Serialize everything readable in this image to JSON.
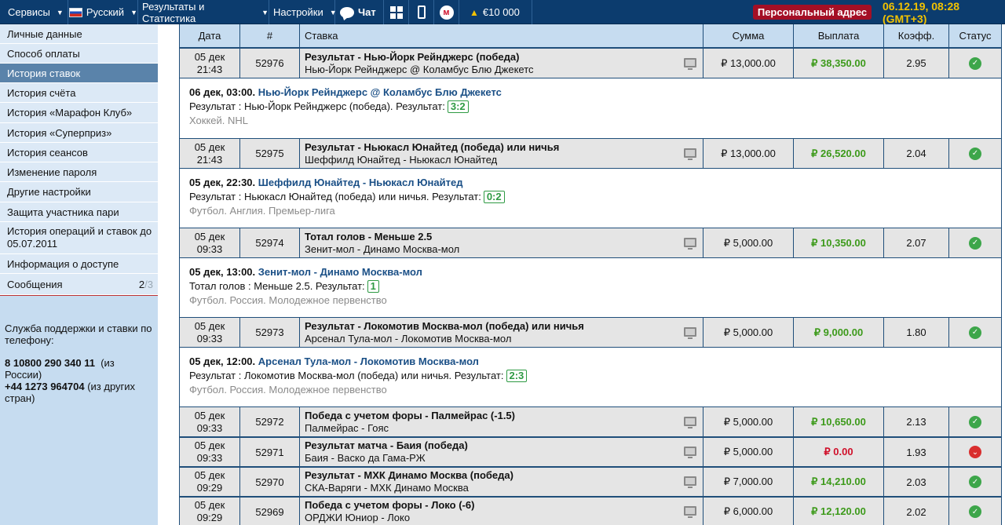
{
  "topbar": {
    "services": "Сервисы",
    "language": "Русский",
    "results": "Результаты и Статистика",
    "settings": "Настройки",
    "chat": "Чат",
    "bonus": "€10 000",
    "personal_address": "Персональный адрес",
    "clock": "06.12.19, 08:28 (GMT+3)"
  },
  "sidebar": {
    "items": [
      {
        "label": "Личные данные"
      },
      {
        "label": "Способ оплаты"
      },
      {
        "label": "История ставок",
        "active": true
      },
      {
        "label": "История счёта"
      },
      {
        "label": "История «Марафон Клуб»"
      },
      {
        "label": "История «Суперприз»"
      },
      {
        "label": "История сеансов"
      },
      {
        "label": "Изменение пароля"
      },
      {
        "label": "Другие настройки"
      },
      {
        "label": "Защита участника пари"
      },
      {
        "label": "История операций и ставок до 05.07.2011"
      },
      {
        "label": "Информация о доступе"
      },
      {
        "label": "Сообщения",
        "count": "2",
        "count_dim": "/3"
      }
    ],
    "support_title": "Служба поддержки и ставки по телефону:",
    "phone_ru": "8 10800 290 340 11",
    "phone_ru_note": "(из России)",
    "phone_intl": "+44 1273 964704",
    "phone_intl_note": "(из других стран)"
  },
  "table": {
    "headers": {
      "date": "Дата",
      "num": "#",
      "stake": "Ставка",
      "sum": "Сумма",
      "pay": "Выплата",
      "coef": "Коэфф.",
      "status": "Статус"
    },
    "rows": [
      {
        "date": "05 дек",
        "time": "21:43",
        "num": "52976",
        "title": "Результат - Нью-Йорк Рейнджерс (победа)",
        "match": "Нью-Йорк Рейнджерс @ Коламбус Блю Джекетс",
        "sum": "₽ 13,000.00",
        "pay": "₽ 38,350.00",
        "coef": "2.95",
        "status": "win",
        "detail": {
          "when": "06 дек, 03:00.",
          "event": "Нью-Йорк Рейнджерс @ Коламбус Блю Джекетс",
          "result_line": "Результат : Нью-Йорк Рейнджерс (победа). Результат:",
          "score": "3:2",
          "league": "Хоккей. NHL"
        }
      },
      {
        "date": "05 дек",
        "time": "21:43",
        "num": "52975",
        "title": "Результат - Ньюкасл Юнайтед (победа) или ничья",
        "match": "Шеффилд Юнайтед - Ньюкасл Юнайтед",
        "sum": "₽ 13,000.00",
        "pay": "₽ 26,520.00",
        "coef": "2.04",
        "status": "win",
        "detail": {
          "when": "05 дек, 22:30.",
          "event": "Шеффилд Юнайтед - Ньюкасл Юнайтед",
          "result_line": "Результат : Ньюкасл Юнайтед (победа) или ничья. Результат:",
          "score": "0:2",
          "league": "Футбол. Англия. Премьер-лига"
        }
      },
      {
        "date": "05 дек",
        "time": "09:33",
        "num": "52974",
        "title": "Тотал голов - Меньше 2.5",
        "match": "Зенит-мол - Динамо Москва-мол",
        "sum": "₽ 5,000.00",
        "pay": "₽ 10,350.00",
        "coef": "2.07",
        "status": "win",
        "detail": {
          "when": "05 дек, 13:00.",
          "event": "Зенит-мол - Динамо Москва-мол",
          "result_line": "Тотал голов : Меньше 2.5. Результат:",
          "score": "1",
          "league": "Футбол. Россия. Молодежное первенство"
        }
      },
      {
        "date": "05 дек",
        "time": "09:33",
        "num": "52973",
        "title": "Результат - Локомотив Москва-мол (победа) или ничья",
        "match": "Арсенал Тула-мол - Локомотив Москва-мол",
        "sum": "₽ 5,000.00",
        "pay": "₽ 9,000.00",
        "coef": "1.80",
        "status": "win",
        "detail": {
          "when": "05 дек, 12:00.",
          "event": "Арсенал Тула-мол - Локомотив Москва-мол",
          "result_line": "Результат : Локомотив Москва-мол (победа) или ничья. Результат:",
          "score": "2:3",
          "league": "Футбол. Россия. Молодежное первенство"
        }
      },
      {
        "date": "05 дек",
        "time": "09:33",
        "num": "52972",
        "title": "Победа с учетом форы - Палмейрас (-1.5)",
        "match": "Палмейрас - Гояс",
        "sum": "₽ 5,000.00",
        "pay": "₽ 10,650.00",
        "coef": "2.13",
        "status": "win"
      },
      {
        "date": "05 дек",
        "time": "09:33",
        "num": "52971",
        "title": "Результат матча - Баия (победа)",
        "match": "Баия - Васко да Гама-РЖ",
        "sum": "₽ 5,000.00",
        "pay": "₽ 0.00",
        "coef": "1.93",
        "status": "loss"
      },
      {
        "date": "05 дек",
        "time": "09:29",
        "num": "52970",
        "title": "Результат - МХК Динамо Москва (победа)",
        "match": "СКА-Варяги - МХК Динамо Москва",
        "sum": "₽ 7,000.00",
        "pay": "₽ 14,210.00",
        "coef": "2.03",
        "status": "win"
      },
      {
        "date": "05 дек",
        "time": "09:29",
        "num": "52969",
        "title": "Победа с учетом форы - Локо (-6)",
        "match": "ОРДЖИ Юниор - Локо",
        "sum": "₽ 6,000.00",
        "pay": "₽ 12,120.00",
        "coef": "2.02",
        "status": "win"
      }
    ]
  },
  "colors": {
    "topbar": "#0c3c6e",
    "sidebar": "#c6dcf0",
    "active_menu": "#5a83aa",
    "win": "#3c9a1a",
    "loss": "#d0102a",
    "link": "#1a4f86"
  }
}
